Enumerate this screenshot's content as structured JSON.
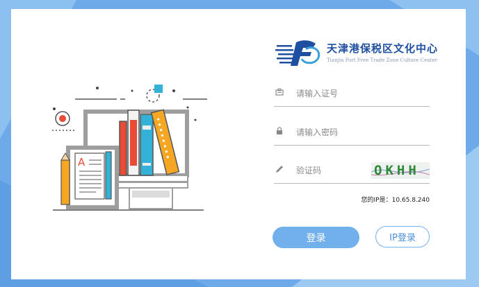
{
  "logo": {
    "title": "天津港保税区文化中心",
    "subtitle": "Tianjin Port Free Trade Zone Culture Center"
  },
  "form": {
    "id_placeholder": "请输入证号",
    "password_placeholder": "请输入密码",
    "captcha_placeholder": "验证码",
    "captcha_text": "OKHH"
  },
  "ip_info": "您的IP是：10.65.8.240",
  "buttons": {
    "login": "登录",
    "ip_login": "IP登录"
  },
  "colors": {
    "background": "#7bb4ec",
    "accent": "#72b0ec",
    "brand": "#1f4fa0"
  }
}
